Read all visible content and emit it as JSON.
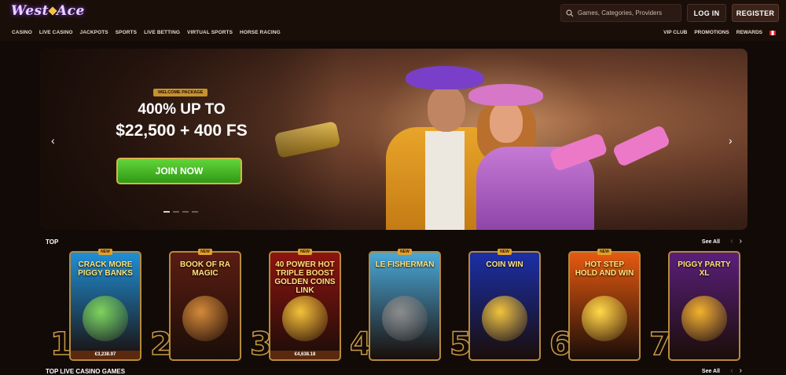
{
  "header": {
    "logo_text_1": "West",
    "logo_text_2": "Ace",
    "search_placeholder": "Games, Categories, Providers",
    "login_label": "LOG IN",
    "register_label": "REGISTER"
  },
  "nav": {
    "left": [
      "CASINO",
      "LIVE CASINO",
      "JACKPOTS",
      "SPORTS",
      "LIVE BETTING",
      "VIRTUAL SPORTS",
      "HORSE RACING"
    ],
    "right": [
      "VIP CLUB",
      "PROMOTIONS",
      "REWARDS"
    ]
  },
  "hero": {
    "badge": "WELCOME PACKAGE",
    "line1": "400% UP TO",
    "line2": "$22,500 + 400 FS",
    "cta": "JOIN NOW",
    "slides_total": 4,
    "slide_active": 1
  },
  "top_section": {
    "title": "TOP",
    "see_all": "See All"
  },
  "games": [
    {
      "rank": "1",
      "title": "CRACK MORE PIGGY BANKS",
      "tag": "NEW",
      "jackpot": "€3,238.97",
      "bg": "#1f8fd6",
      "accent": "#7fd35a"
    },
    {
      "rank": "2",
      "title": "BOOK OF RA MAGIC",
      "tag": "NEW",
      "jackpot": "",
      "bg": "#5a1d12",
      "accent": "#d28a3a"
    },
    {
      "rank": "3",
      "title": "40 POWER HOT TRIPLE BOOST GOLDEN COINS LINK",
      "tag": "NEW",
      "jackpot": "€4,638.18",
      "bg": "#8e1410",
      "accent": "#f3c23a"
    },
    {
      "rank": "4",
      "title": "LE FISHERMAN",
      "tag": "NEW",
      "jackpot": "",
      "bg": "#4aa8d8",
      "accent": "#8c8c8c"
    },
    {
      "rank": "5",
      "title": "COIN WIN",
      "tag": "NEW",
      "jackpot": "",
      "bg": "#1b2fa8",
      "accent": "#f2c33c"
    },
    {
      "rank": "6",
      "title": "HOT STEP HOLD AND WIN",
      "tag": "NEW",
      "jackpot": "",
      "bg": "#e65a10",
      "accent": "#ffd94a"
    },
    {
      "rank": "7",
      "title": "PIGGY PARTY XL",
      "tag": "",
      "jackpot": "",
      "bg": "#5a1f7a",
      "accent": "#f3b22c"
    }
  ],
  "live_section": {
    "title": "TOP LIVE CASINO GAMES",
    "see_all": "See All"
  },
  "colors": {
    "background": "#120a07",
    "gold": "#c89a44",
    "join_green": "#3fae22"
  }
}
